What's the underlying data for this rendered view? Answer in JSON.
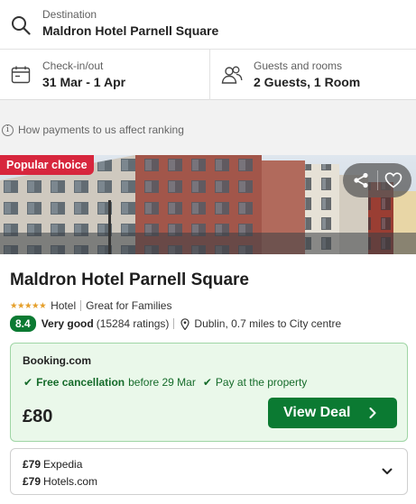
{
  "search": {
    "destination_label": "Destination",
    "destination_value": "Maldron Hotel Parnell Square",
    "dates_label": "Check-in/out",
    "dates_value": "31 Mar - 1 Apr",
    "guests_label": "Guests and rooms",
    "guests_value": "2 Guests, 1 Room"
  },
  "ranking_note": "How payments to us affect ranking",
  "hotel": {
    "badge": "Popular choice",
    "name": "Maldron Hotel Parnell Square",
    "stars_text": "★★★★★",
    "type": "Hotel",
    "tag": "Great for Families",
    "score": "8.4",
    "rating_word": "Very good",
    "ratings_count": "(15284 ratings)",
    "location": "Dublin, 0.7 miles to City centre"
  },
  "deal": {
    "provider": "Booking.com",
    "free_cancellation": "Free cancellation",
    "cancellation_date": "before 29 Mar",
    "pay_at_property": "Pay at the property",
    "price": "£80",
    "button_label": "View Deal"
  },
  "other_deals": [
    {
      "price": "£79",
      "provider": "Expedia"
    },
    {
      "price": "£79",
      "provider": "Hotels.com"
    }
  ],
  "colors": {
    "accent_green": "#0b7a32",
    "badge_red": "#d7263d",
    "deal_bg": "#eaf8ea"
  },
  "icons": [
    "search-icon",
    "calendar-icon",
    "people-icon",
    "info-icon",
    "share-icon",
    "heart-icon",
    "map-pin-icon",
    "check-icon",
    "chevron-right-icon",
    "chevron-down-icon"
  ]
}
